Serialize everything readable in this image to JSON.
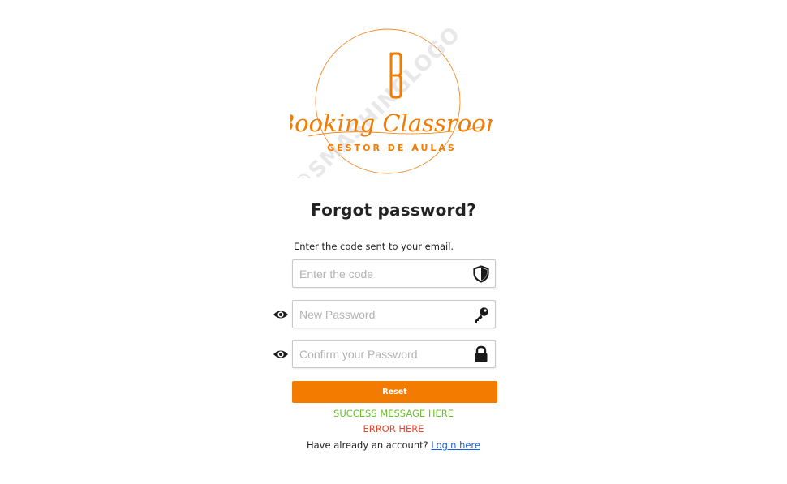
{
  "logo": {
    "brand_name": "Booking Classroom",
    "tagline": "GESTOR DE AULAS",
    "watermark": "©SMASHINGLOGO",
    "icon": "bookmark-b-icon"
  },
  "form": {
    "title": "Forgot password?",
    "instruction": "Enter the code sent to your email.",
    "code": {
      "placeholder": "Enter the code",
      "value": "",
      "icon": "shield-icon"
    },
    "new_password": {
      "placeholder": "New Password",
      "value": "",
      "icon": "key-icon",
      "toggle_icon": "eye-icon"
    },
    "confirm_password": {
      "placeholder": "Confirm your Password",
      "value": "",
      "icon": "lock-icon",
      "toggle_icon": "eye-icon"
    },
    "reset_label": "Reset",
    "success_message": "SUCCESS MESSAGE HERE",
    "error_message": "ERROR HERE",
    "login_prompt": "Have already an account?",
    "login_link": "Login here"
  },
  "colors": {
    "accent": "#f27b00",
    "success": "#6abf2e",
    "error": "#e8452c",
    "link": "#1a5fd6"
  }
}
